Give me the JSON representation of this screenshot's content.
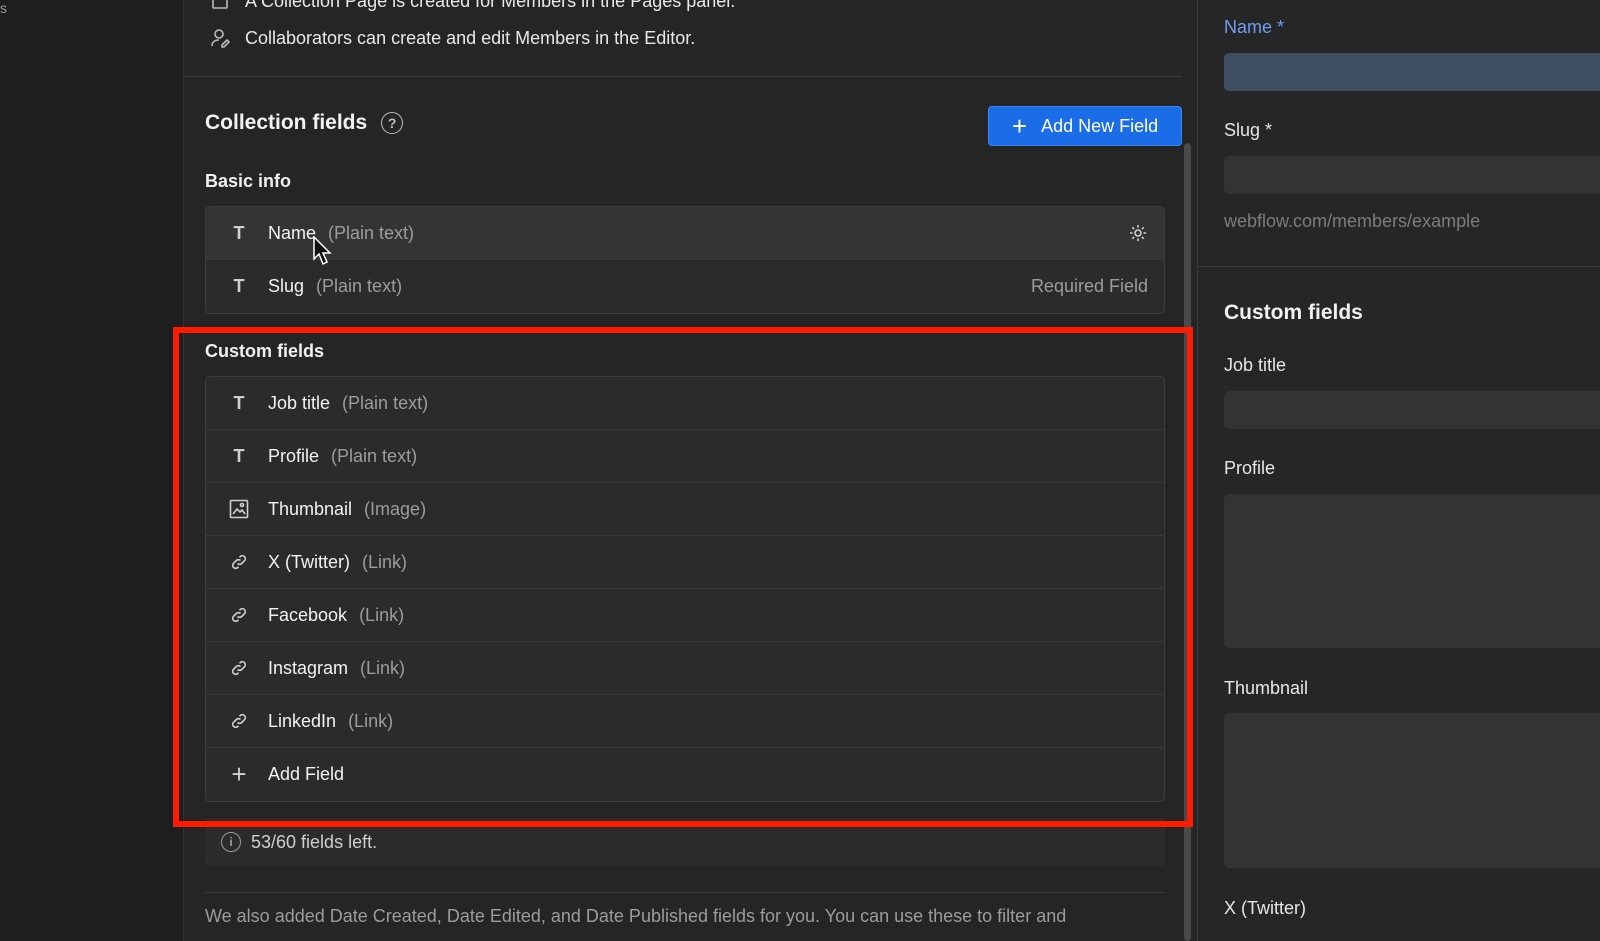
{
  "left_rail": {
    "tick": "s"
  },
  "info": {
    "line1": "A Collection Page is created for Members in the Pages panel.",
    "line2": "Collaborators can create and edit Members in the Editor."
  },
  "collection_fields": {
    "title": "Collection fields",
    "help": "?",
    "add_new_label": "Add New Field"
  },
  "basic_info": {
    "label": "Basic info",
    "fields": [
      {
        "name": "Name",
        "type": "(Plain text)",
        "icon": "text-icon"
      },
      {
        "name": "Slug",
        "type": "(Plain text)",
        "icon": "text-icon",
        "right": "Required Field"
      }
    ]
  },
  "custom_fields": {
    "label": "Custom fields",
    "fields": [
      {
        "name": "Job title",
        "type": "(Plain text)",
        "icon": "text-icon"
      },
      {
        "name": "Profile",
        "type": "(Plain text)",
        "icon": "text-icon"
      },
      {
        "name": "Thumbnail",
        "type": "(Image)",
        "icon": "image-icon"
      },
      {
        "name": "X (Twitter)",
        "type": "(Link)",
        "icon": "link-icon"
      },
      {
        "name": "Facebook",
        "type": "(Link)",
        "icon": "link-icon"
      },
      {
        "name": "Instagram",
        "type": "(Link)",
        "icon": "link-icon"
      },
      {
        "name": "LinkedIn",
        "type": "(Link)",
        "icon": "link-icon"
      }
    ],
    "add_label": "Add Field"
  },
  "fields_left": "53/60 fields left.",
  "footnote": "We also added Date Created, Date Edited, and Date Published fields for you. You can use these to filter and",
  "preview": {
    "name_label": "Name *",
    "slug_label": "Slug *",
    "slug_hint": "webflow.com/members/example",
    "custom_title": "Custom fields",
    "job_title_label": "Job title",
    "profile_label": "Profile",
    "thumbnail_label": "Thumbnail",
    "twitter_label": "X (Twitter)"
  },
  "colors": {
    "accent": "#1a6de6",
    "highlight": "#ff1a00",
    "label_accent": "#6f9cf0"
  }
}
